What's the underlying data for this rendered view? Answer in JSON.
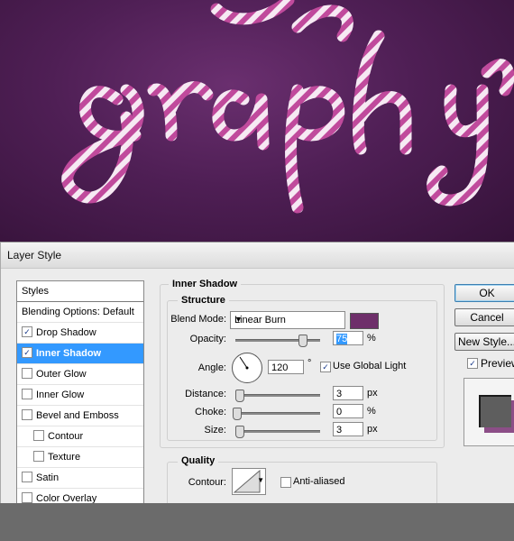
{
  "dialog": {
    "title": "Layer Style"
  },
  "style_list": {
    "header": "Styles",
    "blending": "Blending Options: Default",
    "items": [
      {
        "label": "Drop Shadow",
        "checked": true
      },
      {
        "label": "Inner Shadow",
        "checked": true,
        "selected": true
      },
      {
        "label": "Outer Glow",
        "checked": false
      },
      {
        "label": "Inner Glow",
        "checked": false
      },
      {
        "label": "Bevel and Emboss",
        "checked": false
      },
      {
        "label": "Contour",
        "checked": false
      },
      {
        "label": "Texture",
        "checked": false
      },
      {
        "label": "Satin",
        "checked": false
      },
      {
        "label": "Color Overlay",
        "checked": false
      }
    ]
  },
  "inner_shadow": {
    "section_title": "Inner Shadow",
    "structure_title": "Structure",
    "blend_mode_label": "Blend Mode:",
    "blend_mode_value": "Linear Burn",
    "shadow_color": "#6e2f6a",
    "opacity_label": "Opacity:",
    "opacity_value": "75",
    "opacity_unit": "%",
    "angle_label": "Angle:",
    "angle_value": "120",
    "angle_unit": "°",
    "use_global_light_label": "Use Global Light",
    "use_global_light": true,
    "distance_label": "Distance:",
    "distance_value": "3",
    "distance_unit": "px",
    "choke_label": "Choke:",
    "choke_value": "0",
    "choke_unit": "%",
    "size_label": "Size:",
    "size_value": "3",
    "size_unit": "px",
    "quality_title": "Quality",
    "contour_label": "Contour:",
    "anti_aliased_label": "Anti-aliased",
    "anti_aliased": false
  },
  "buttons": {
    "ok": "OK",
    "cancel": "Cancel",
    "new_style": "New Style...",
    "preview_label": "Preview",
    "preview_checked": true
  }
}
